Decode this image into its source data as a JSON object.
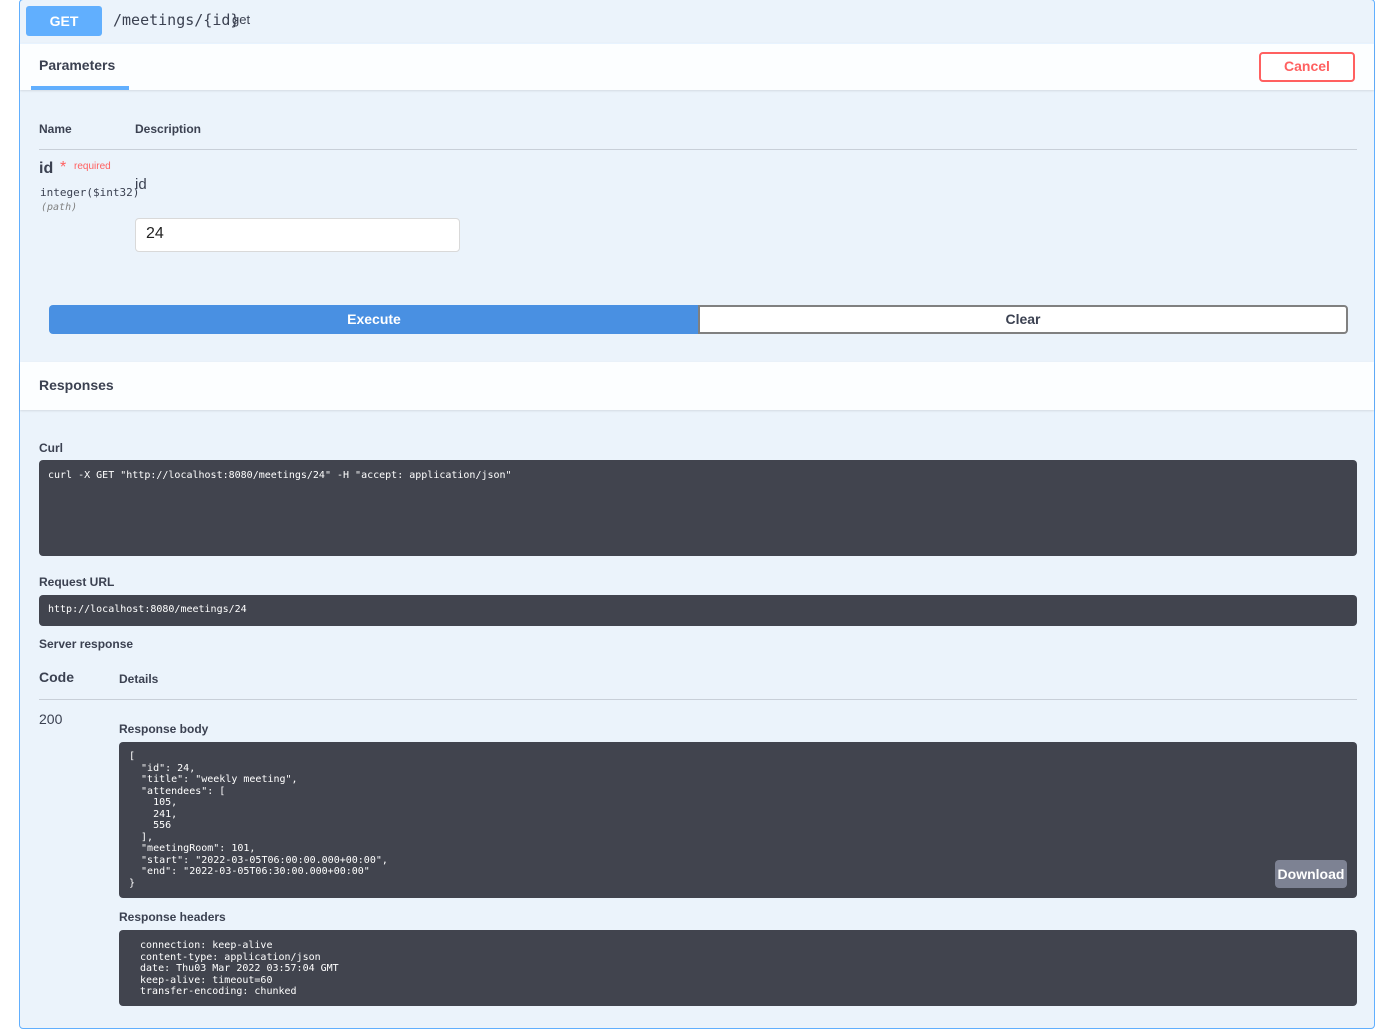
{
  "operation": {
    "method": "GET",
    "path": "/meetings/{id}",
    "summary": "get"
  },
  "parameters": {
    "tab_label": "Parameters",
    "cancel_label": "Cancel",
    "col_name": "Name",
    "col_description": "Description",
    "param": {
      "name": "id",
      "required_star": "*",
      "required_label": "required",
      "type": "integer($int32)",
      "in": "(path)",
      "description": "id",
      "value": "24"
    }
  },
  "actions": {
    "execute_label": "Execute",
    "clear_label": "Clear"
  },
  "responses": {
    "title": "Responses",
    "curl_label": "Curl",
    "curl_command": "curl -X GET \"http://localhost:8080/meetings/24\" -H \"accept: application/json\"",
    "request_url_label": "Request URL",
    "request_url": "http://localhost:8080/meetings/24",
    "server_response_label": "Server response",
    "col_code": "Code",
    "col_details": "Details",
    "status_code": "200",
    "body_label": "Response body",
    "body": "[\n  \"id\": 24,\n  \"title\": \"weekly meeting\",\n  \"attendees\": [\n    105,\n    241,\n    556\n  ],\n  \"meetingRoom\": 101,\n  \"start\": \"2022-03-05T06:00:00.000+00:00\",\n  \"end\": \"2022-03-05T06:30:00.000+00:00\"\n}",
    "download_label": "Download",
    "headers_label": "Response headers",
    "headers": " connection: keep-alive\n content-type: application/json\n date: Thu03 Mar 2022 03:57:04 GMT\n keep-alive: timeout=60\n transfer-encoding: chunked"
  },
  "colors": {
    "accent": "#61affe",
    "execute": "#4990e2",
    "danger": "#ff6060",
    "code_bg": "#41444e"
  }
}
